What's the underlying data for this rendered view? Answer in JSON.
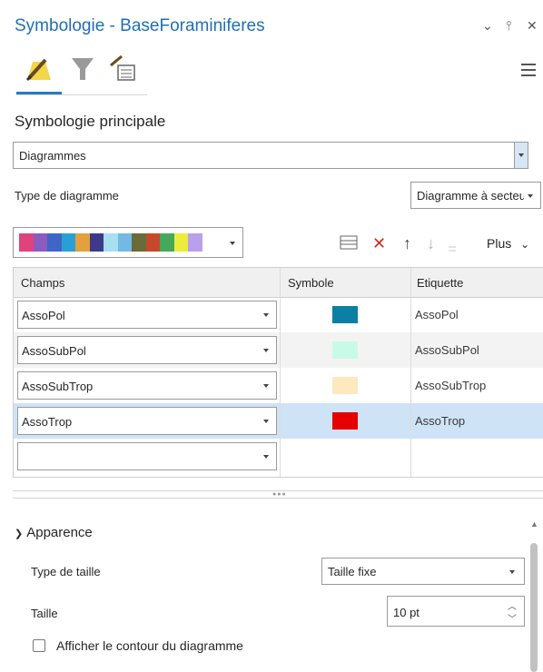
{
  "pane": {
    "title": "Symbologie - BaseForaminiferes",
    "controls": {
      "dropdown": "⌄",
      "pin": "⫯",
      "close": "✕"
    }
  },
  "tabs": [
    "primary-symbology-icon",
    "filter-icon",
    "label-icon"
  ],
  "section_title": "Symbologie principale",
  "symbology_select": {
    "value": "Diagrammes"
  },
  "chart_type": {
    "label": "Type de diagramme",
    "value": "Diagramme à secteurs"
  },
  "color_ramp": {
    "colors": [
      "#e0427c",
      "#8a5cc0",
      "#3f66c4",
      "#2a9fd6",
      "#e2a13c",
      "#3e3a8b",
      "#a7e0f2",
      "#73b9e3",
      "#6a6a3a",
      "#c54a2c",
      "#45a85a",
      "#ecec3c",
      "#b9a0ec"
    ]
  },
  "toolbar": {
    "more_label": "Plus"
  },
  "grid": {
    "headers": {
      "field": "Champs",
      "symbol": "Symbole",
      "label": "Etiquette"
    },
    "rows": [
      {
        "field": "AssoPol",
        "color": "#0c7fa4",
        "label": "AssoPol"
      },
      {
        "field": "AssoSubPol",
        "color": "#c8fbe6",
        "label": "AssoSubPol"
      },
      {
        "field": "AssoSubTrop",
        "color": "#fde9c0",
        "label": "AssoSubTrop"
      },
      {
        "field": "AssoTrop",
        "color": "#e60000",
        "label": "AssoTrop"
      },
      {
        "field": "",
        "color": "",
        "label": ""
      }
    ]
  },
  "appearance": {
    "header": "Apparence",
    "size_type_label": "Type de taille",
    "size_type_value": "Taille fixe",
    "size_label": "Taille",
    "size_value": "10 pt",
    "outline_label": "Afficher le contour du diagramme"
  }
}
